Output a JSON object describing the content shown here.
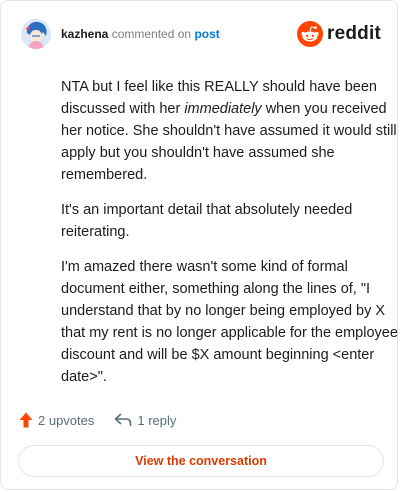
{
  "header": {
    "username": "kazhena",
    "action": "commented on",
    "target": "post",
    "brand": "reddit"
  },
  "comment": {
    "paragraphs": [
      {
        "before": "NTA but I feel like this REALLY should have been discussed with her ",
        "emphasis": "immediately",
        "after": " when you received her notice. She shouldn't have assumed it would still apply but you shouldn't have assumed she remembered."
      },
      {
        "text": "It's an important detail that absolutely needed reiterating."
      },
      {
        "text": "I'm amazed there wasn't some kind of formal document either, something along the lines of, \"I understand that by no longer being employed by X that my rent is no longer applicable for the employee discount and will be $X amount beginning <enter date>\"."
      }
    ]
  },
  "stats": {
    "upvotes": "2 upvotes",
    "replies": "1 reply"
  },
  "cta": {
    "label": "View the conversation"
  },
  "colors": {
    "brand_orange": "#ff4500",
    "link_blue": "#0079d3",
    "cta_text": "#d93a00",
    "muted": "#576f76"
  },
  "icons": {
    "avatar": "user-avatar",
    "logo": "reddit-logo-icon",
    "upvote": "upvote-arrow-icon",
    "reply": "reply-arrow-icon"
  }
}
